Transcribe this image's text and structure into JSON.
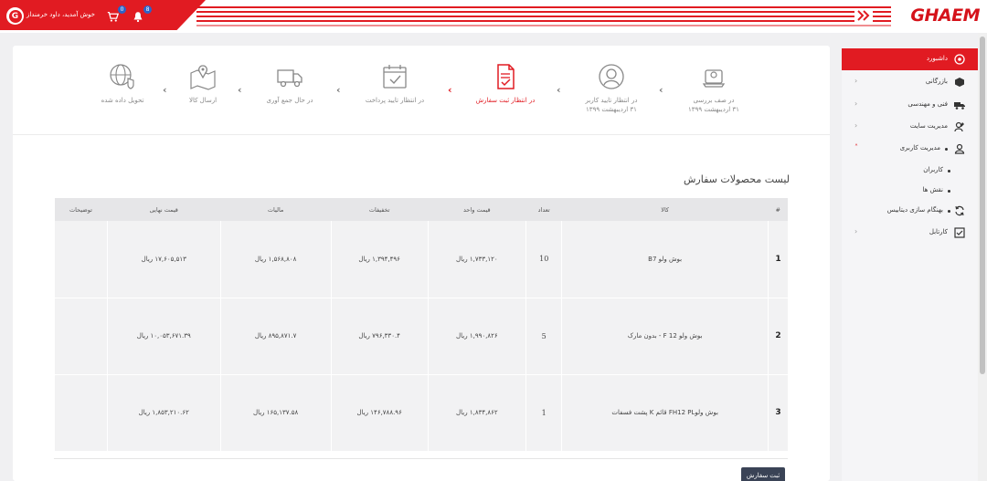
{
  "header": {
    "greeting": "خوش آمدید، داود خرمنداز",
    "logo": "GHAEM",
    "cart_badge": "0",
    "bell_badge": "8"
  },
  "sidebar": {
    "items": [
      {
        "label": "داشبورد",
        "icon": "dashboard-icon"
      },
      {
        "label": "بازرگانی",
        "icon": "box-icon"
      },
      {
        "label": "فنی و مهندسی",
        "icon": "truck-icon"
      },
      {
        "label": "مدیریت سایت",
        "icon": "user-edit-icon"
      },
      {
        "label": "مدیریت کاربری",
        "icon": "user-icon"
      },
      {
        "label": "کاربران",
        "icon": ""
      },
      {
        "label": "نقش ها",
        "icon": ""
      },
      {
        "label": "بهنگام سازی دیتابیس",
        "icon": "sync-icon"
      },
      {
        "label": "کارتابل",
        "icon": "inbox-icon"
      }
    ]
  },
  "steps": [
    {
      "label": "در صف بررسی",
      "date": "۳۱ اردیبهشت ۱۳۹۹"
    },
    {
      "label": "در انتظار تایید کاربر",
      "date": "۳۱ اردیبهشت ۱۳۹۹"
    },
    {
      "label": "در انتظار ثبت سفارش",
      "date": ""
    },
    {
      "label": "در انتظار تایید پرداخت",
      "date": ""
    },
    {
      "label": "در حال جمع آوری",
      "date": ""
    },
    {
      "label": "ارسال کالا",
      "date": ""
    },
    {
      "label": "تحویل داده شده",
      "date": ""
    }
  ],
  "list_title": "لیست محصولات سفارش",
  "table": {
    "headers": [
      "#",
      "کالا",
      "تعداد",
      "قیمت واحد",
      "تخفیفات",
      "مالیات",
      "قیمت نهایی",
      "توضیحات"
    ],
    "rows": [
      {
        "num": "1",
        "product": "بوش ولو B7",
        "qty": "10",
        "unit": "۱,۷۳۳,۱۲۰ ریال",
        "discount": "۱,۳۹۴,۴۹۶ ریال",
        "tax": "۱,۵۶۸,۸۰۸ ریال",
        "final": "۱۷,۶۰۵,۵۱۳ ریال",
        "notes": ""
      },
      {
        "num": "2",
        "product": "بوش ولو F 12 - بدون مارک",
        "qty": "5",
        "unit": "۱,۹۹۰,۸۲۶ ریال",
        "discount": "۷۹۶,۳۳۰.۴ ریال",
        "tax": "۸۹۵,۸۷۱.۷ ریال",
        "final": "۱۰,۰۵۳,۶۷۱.۳۹ ریال",
        "notes": ""
      },
      {
        "num": "3",
        "product": "بوش ولوFH12 PL قائم K پشت فسفات",
        "qty": "1",
        "unit": "۱,۸۳۴,۸۶۲ ریال",
        "discount": "۱۴۶,۷۸۸.۹۶ ریال",
        "tax": "۱۶۵,۱۳۷.۵۸ ریال",
        "final": "۱,۸۵۳,۲۱۰.۶۲ ریال",
        "notes": ""
      }
    ]
  },
  "submit_label": "ثبت سفارش",
  "colors": {
    "accent": "#e11b22",
    "dark_button": "#3a4356"
  }
}
